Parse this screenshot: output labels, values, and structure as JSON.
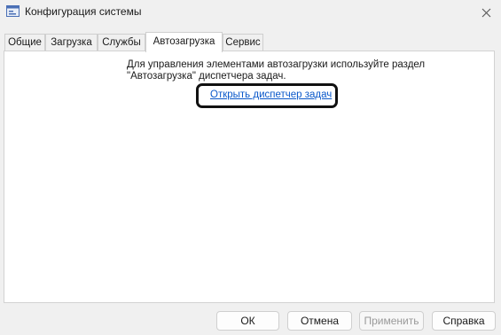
{
  "window": {
    "title": "Конфигурация системы",
    "app_icon": "msconfig-icon",
    "close_icon": "close-icon"
  },
  "tabs": [
    {
      "label": "Общие",
      "active": false
    },
    {
      "label": "Загрузка",
      "active": false
    },
    {
      "label": "Службы",
      "active": false
    },
    {
      "label": "Автозагрузка",
      "active": true
    },
    {
      "label": "Сервис",
      "active": false
    }
  ],
  "startup": {
    "description_line1": "Для управления элементами автозагрузки используйте раздел",
    "description_line2": "\"Автозагрузка\" диспетчера задач.",
    "link_label": "Открыть диспетчер задач"
  },
  "buttons": {
    "ok": "ОК",
    "cancel": "Отмена",
    "apply": "Применить",
    "help": "Справка"
  },
  "colors": {
    "link": "#0a58ca",
    "highlight_border": "#111111",
    "disabled_text": "#9a9a9a"
  }
}
